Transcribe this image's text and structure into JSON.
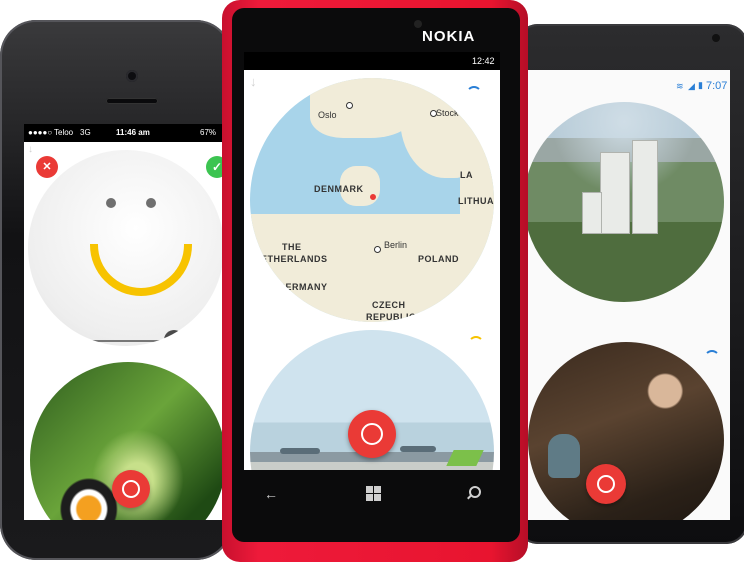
{
  "colors": {
    "record_red": "#ea3a36",
    "confirm_green": "#3cc451",
    "smile_yellow": "#f7c300",
    "accent_blue": "#2a7fd6",
    "nokia_red": "#e8142f"
  },
  "left_phone": {
    "status": {
      "signal": "●●●●○",
      "carrier": "Teloo",
      "network": "3G",
      "time": "11:46 am",
      "battery": "67%"
    },
    "scrubber_icon": "pause-icon",
    "scrubber_glyph": "III",
    "scrubber_progress": 0.9,
    "cancel_glyph": "✕",
    "confirm_glyph": "✓"
  },
  "center_phone": {
    "brand": "NOKIA",
    "status": {
      "time": "12:42"
    },
    "map": {
      "countries": [
        "DENMARK",
        "THE",
        "NETHERLANDS",
        "GERMANY",
        "POLAND",
        "CZECH",
        "REPUBLIC",
        "LITHUA",
        "LA"
      ],
      "cities": [
        "Oslo",
        "Stock",
        "Berlin"
      ]
    },
    "nav": {
      "back": "←",
      "home": "windows-icon",
      "search": "search-icon"
    }
  },
  "right_phone": {
    "status": {
      "time": "7:07"
    }
  }
}
